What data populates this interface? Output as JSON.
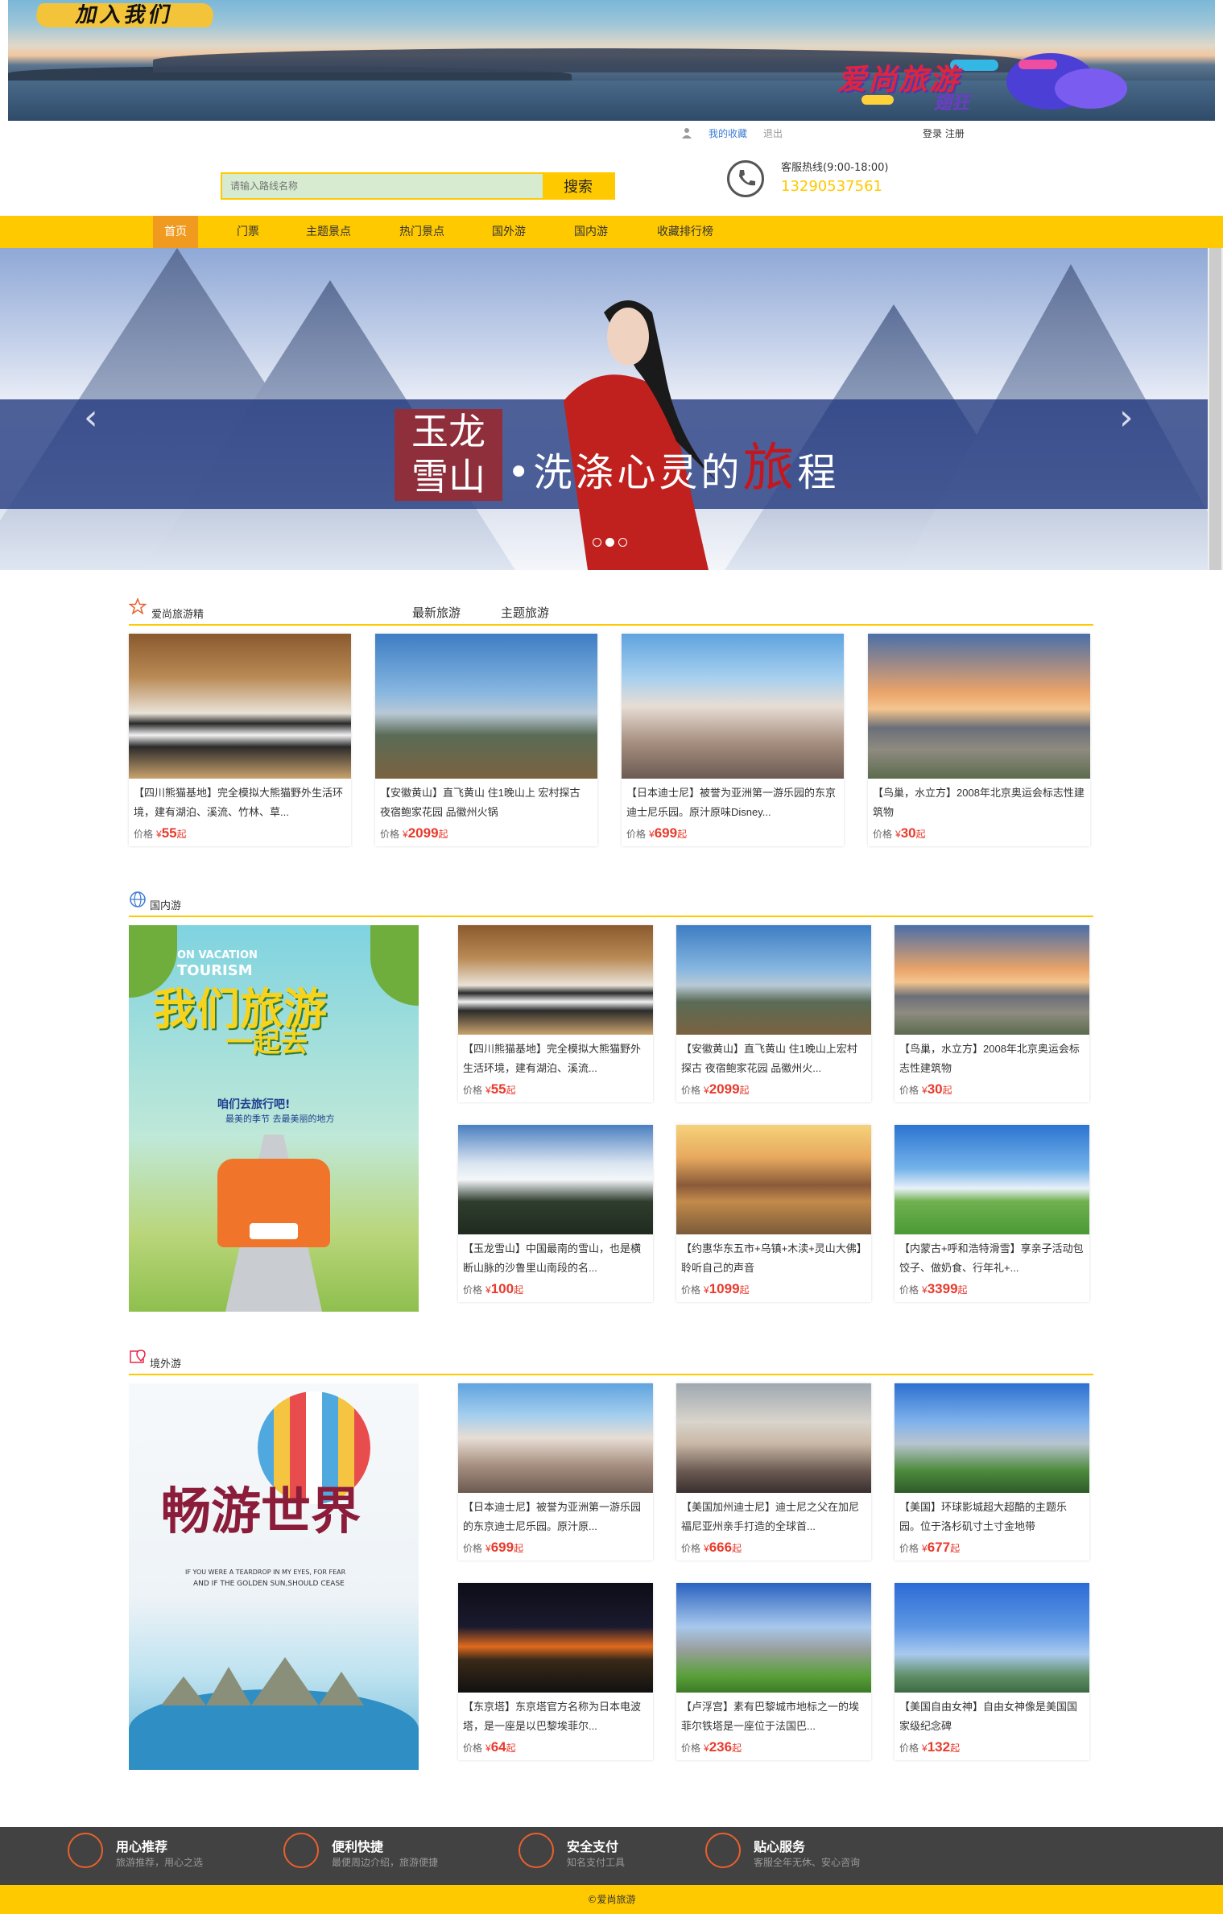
{
  "top_banner": {
    "join_logo": "加入我们",
    "brand": "爱尚旅游",
    "brand_sub": "翅狂"
  },
  "header": {
    "my_favorites": "我的收藏",
    "logout": "退出",
    "login_register": "登录 注册",
    "search_placeholder": "请输入路线名称",
    "search_button": "搜索",
    "hotline_label": "客服热线(9:00-18:00)",
    "hotline_number": "13290537561"
  },
  "nav": [
    {
      "label": "首页"
    },
    {
      "label": "门票"
    },
    {
      "label": "主题景点"
    },
    {
      "label": "热门景点"
    },
    {
      "label": "国外游"
    },
    {
      "label": "国内游"
    },
    {
      "label": "收藏排行榜"
    }
  ],
  "hero": {
    "title_line1": "玉龙",
    "title_line2": "雪山",
    "slogan_prefix": "•洗涤心灵的",
    "slogan_red": "旅",
    "slogan_suffix": "程",
    "prev": "‹",
    "next": "›",
    "active_slide": 2,
    "slide_count": 3
  },
  "featured": {
    "title": "爱尚旅游精",
    "tabs": [
      "最新旅游",
      "主题旅游"
    ],
    "price_label": "价格",
    "currency": "¥",
    "suffix": "起",
    "items": [
      {
        "desc": "【四川熊猫基地】完全模拟大熊猫野外生活环境，建有湖泊、溪流、竹林、草...",
        "price": "55",
        "img": "panda"
      },
      {
        "desc": "【安徽黄山】直飞黄山 住1晚山上 宏村探古 夜宿鲍家花园 品徽州火锅",
        "price": "2099",
        "img": "mountain"
      },
      {
        "desc": "【日本迪士尼】被誉为亚洲第一游乐园的东京迪士尼乐园。原汁原味Disney...",
        "price": "699",
        "img": "castle"
      },
      {
        "desc": "【鸟巢，水立方】2008年北京奥运会标志性建筑物",
        "price": "30",
        "img": "nest"
      }
    ]
  },
  "domestic": {
    "title": "国内游",
    "poster": {
      "en1": "ON VACATION",
      "en2": "TOURISM",
      "big1": "我们旅游",
      "big2": "一起去",
      "line1": "咱们去旅行吧!",
      "line2": "最美的季节 去最美丽的地方"
    },
    "items": [
      {
        "desc": "【四川熊猫基地】完全模拟大熊猫野外生活环境，建有湖泊、溪流...",
        "price": "55",
        "img": "panda"
      },
      {
        "desc": "【安徽黄山】直飞黄山 住1晚山上宏村探古 夜宿鲍家花园 品徽州火...",
        "price": "2099",
        "img": "mountain"
      },
      {
        "desc": "【鸟巢，水立方】2008年北京奥运会标志性建筑物",
        "price": "30",
        "img": "nest"
      },
      {
        "desc": "【玉龙雪山】中国最南的雪山，也是横断山脉的沙鲁里山南段的名...",
        "price": "100",
        "img": "snow"
      },
      {
        "desc": "【约惠华东五市+乌镇+木渎+灵山大佛】聆听自己的声音",
        "price": "1099",
        "img": "town"
      },
      {
        "desc": "【内蒙古+呼和浩特滑雪】享亲子活动包饺子、做奶食、行年礼+...",
        "price": "3399",
        "img": "grass"
      }
    ]
  },
  "abroad": {
    "title": "境外游",
    "poster": {
      "big": "畅游世界",
      "line1": "IF YOU WERE A TEARDROP IN MY EYES, FOR FEAR",
      "line2": "AND IF THE GOLDEN SUN,SHOULD CEASE"
    },
    "items": [
      {
        "desc": "【日本迪士尼】被誉为亚洲第一游乐园的东京迪士尼乐园。原汁原...",
        "price": "699",
        "img": "castle"
      },
      {
        "desc": "【美国加州迪士尼】迪士尼之父在加尼福尼亚州亲手打造的全球首...",
        "price": "666",
        "img": "castle2"
      },
      {
        "desc": "【美国】环球影城超大超酷的主题乐园。位于洛杉矶寸土寸金地带",
        "price": "677",
        "img": "globe"
      },
      {
        "desc": "【东京塔】东京塔官方名称为日本电波塔，是一座是以巴黎埃菲尔...",
        "price": "64",
        "img": "night"
      },
      {
        "desc": "【卢浮宫】素有巴黎城市地标之一的埃菲尔铁塔是一座位于法国巴...",
        "price": "236",
        "img": "eiffel"
      },
      {
        "desc": "【美国自由女神】自由女神像是美国国家级纪念碑",
        "price": "132",
        "img": "liberty"
      }
    ]
  },
  "footer": {
    "features": [
      {
        "title": "用心推荐",
        "sub": "旅游推荐，用心之选",
        "icon": "grid-icon"
      },
      {
        "title": "便利快捷",
        "sub": "最便周边介绍，旅游便捷",
        "icon": "rocket-icon"
      },
      {
        "title": "安全支付",
        "sub": "知名支付工具",
        "icon": "shield-icon"
      },
      {
        "title": "贴心服务",
        "sub": "客服全年无休、安心咨询",
        "icon": "thumb-icon"
      }
    ],
    "copyright": "©爱尚旅游"
  },
  "colors": {
    "brand_yellow": "#ffc900",
    "nav_active": "#f09a1f",
    "price_red": "#e83a2c",
    "footer_bg": "#424242"
  }
}
